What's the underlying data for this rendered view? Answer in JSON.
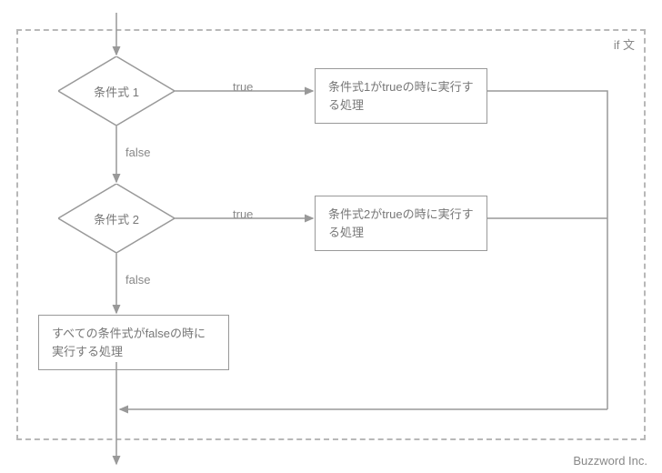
{
  "container_label": "if 文",
  "decision1": "条件式 1",
  "decision2": "条件式 2",
  "process1": "条件式1がtrueの時に実行する処理",
  "process2": "条件式2がtrueの時に実行する処理",
  "process_else": "すべての条件式がfalseの時に実行する処理",
  "label_true1": "true",
  "label_false1": "false",
  "label_true2": "true",
  "label_false2": "false",
  "footer": "Buzzword Inc.",
  "colors": {
    "stroke": "#999999"
  }
}
